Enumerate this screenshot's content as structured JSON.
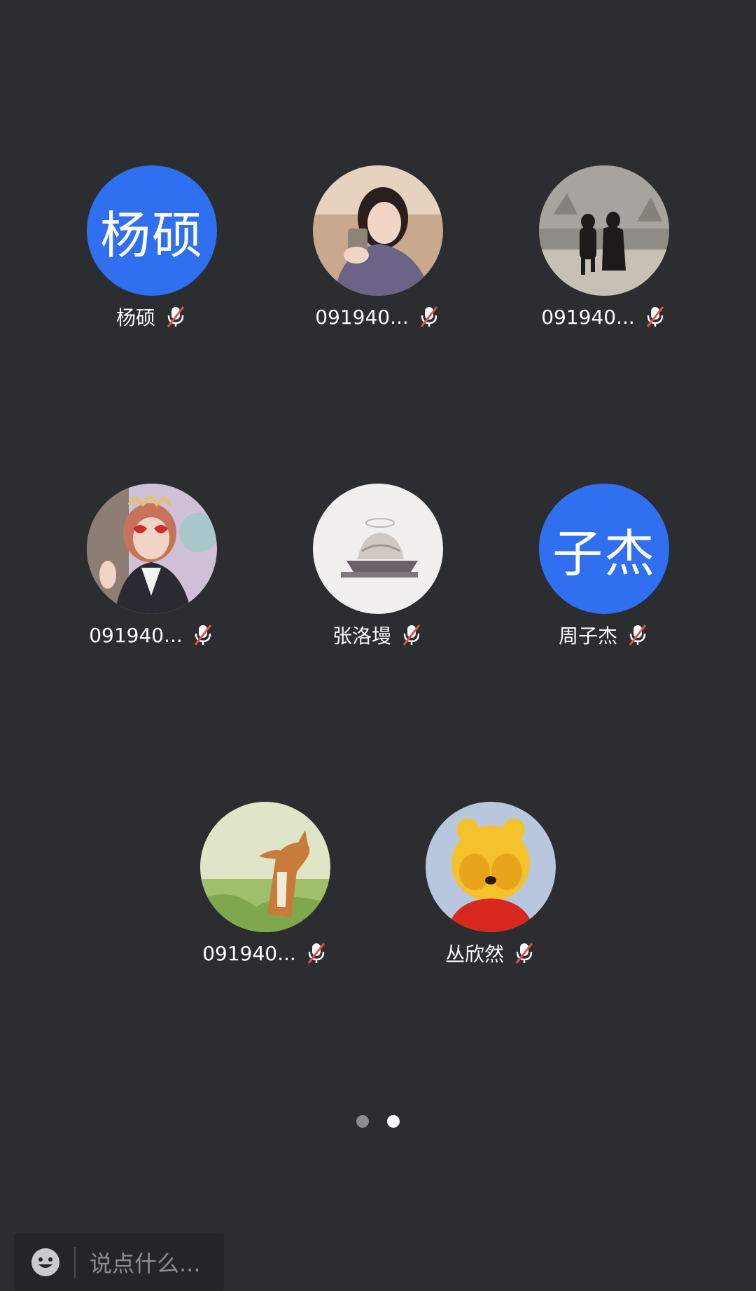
{
  "participants": [
    {
      "name": "杨硕",
      "avatar_type": "text",
      "avatar_text": "杨硕",
      "avatar_color": "#2f6ff0",
      "mic": "muted"
    },
    {
      "name": "091940...",
      "avatar_type": "photo",
      "avatar_desc": "woman-holding-cup",
      "mic": "muted"
    },
    {
      "name": "091940...",
      "avatar_type": "photo",
      "avatar_desc": "two-people-walking",
      "mic": "muted"
    },
    {
      "name": "091940...",
      "avatar_type": "photo",
      "avatar_desc": "girl-heart-glasses",
      "mic": "muted"
    },
    {
      "name": "张洛墁",
      "avatar_type": "photo",
      "avatar_desc": "ice-cream-halo",
      "mic": "muted"
    },
    {
      "name": "周子杰",
      "avatar_type": "text",
      "avatar_text": "子杰",
      "avatar_color": "#2f6ff0",
      "mic": "muted"
    },
    {
      "name": "091940...",
      "avatar_type": "photo",
      "avatar_desc": "fox",
      "mic": "muted"
    },
    {
      "name": "丛欣然",
      "avatar_type": "photo",
      "avatar_desc": "winnie-the-pooh",
      "mic": "muted"
    }
  ],
  "pager": {
    "count": 2,
    "active_index": 1
  },
  "input": {
    "placeholder": "说点什么..."
  },
  "colors": {
    "background": "#2b2d31",
    "accent": "#2f6ff0",
    "mute_slash": "#e0524a"
  }
}
